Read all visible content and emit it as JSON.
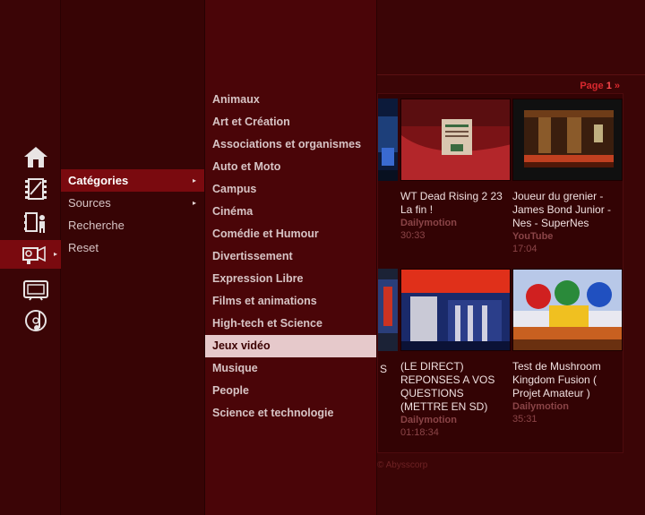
{
  "icons": [
    {
      "name": "home-icon"
    },
    {
      "name": "film-icon"
    },
    {
      "name": "film-person-icon"
    },
    {
      "name": "video-camera-icon"
    },
    {
      "name": "tv-icon"
    },
    {
      "name": "music-icon"
    }
  ],
  "menu": {
    "items": [
      {
        "label": "Catégories",
        "has_submenu": true,
        "selected": true
      },
      {
        "label": "Sources",
        "has_submenu": true,
        "selected": false
      },
      {
        "label": "Recherche",
        "has_submenu": false,
        "selected": false
      },
      {
        "label": "Reset",
        "has_submenu": false,
        "selected": false
      }
    ],
    "submenu_arrow": "▸"
  },
  "categories": [
    "Animaux",
    "Art et Création",
    "Associations et organismes",
    "Auto et Moto",
    "Campus",
    "Cinéma",
    "Comédie et Humour",
    "Divertissement",
    "Expression Libre",
    "Films et animations",
    "High-tech et Science",
    "Jeux vidéo",
    "Musique",
    "People",
    "Science et technologie"
  ],
  "selected_category": "Jeux vidéo",
  "content": {
    "page_label": "Page",
    "page_number": "1",
    "page_next": "»",
    "partial_title_fragment": "S",
    "videos": [
      {
        "title": "WT Dead Rising 2 23 La fin !",
        "source": "Dailymotion",
        "duration": "30:33"
      },
      {
        "title": "Joueur du grenier - James Bond Junior - Nes - SuperNes",
        "source": "YouTube",
        "duration": "17:04"
      },
      {
        "title": "(LE DIRECT) REPONSES A VOS QUESTIONS (METTRE EN SD)",
        "source": "Dailymotion",
        "duration": "01:18:34"
      },
      {
        "title": "Test de Mushroom Kingdom Fusion ( Projet Amateur )",
        "source": "Dailymotion",
        "duration": "35:31"
      }
    ],
    "footer": "© Abysscorp"
  },
  "colors": {
    "background": "#3d0506",
    "highlight": "#7a0a0f",
    "category_selected": "#e6c9cb",
    "accent": "#d9282e"
  }
}
